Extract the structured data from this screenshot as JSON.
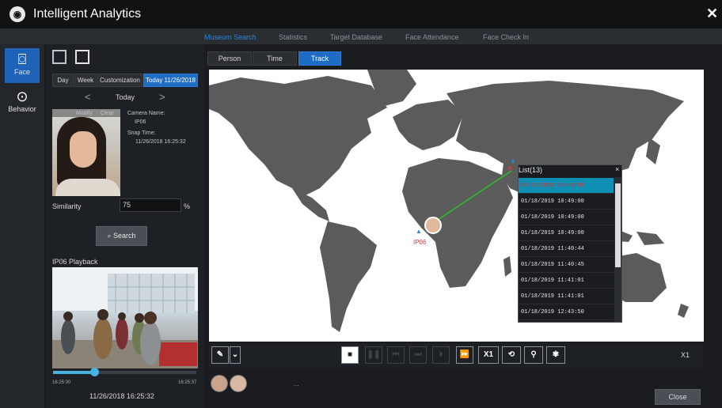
{
  "window": {
    "title": "Intelligent Analytics",
    "close_glyph": "✕"
  },
  "nav": {
    "tabs": [
      "Museum Search",
      "Statistics",
      "Target Database",
      "Face Attendance",
      "Face Check In"
    ],
    "active": "Museum Search"
  },
  "rail": {
    "items": [
      {
        "label": "Face",
        "icon": "face-scan-icon",
        "active": true
      },
      {
        "label": "Behavior",
        "icon": "behavior-search-icon",
        "active": false
      }
    ]
  },
  "left": {
    "range_tabs": [
      "Day",
      "Week",
      "Customization",
      "Today 11/26/2018"
    ],
    "date_nav": {
      "prev": "<",
      "label": "Today",
      "next": ">"
    },
    "snapshot": {
      "modify": "Modify",
      "clear": "Clear",
      "camera_name_label": "Camera Name:",
      "camera_name": "IP06",
      "snap_time_label": "Snap Time:",
      "snap_time": "11/26/2018 16:25:32"
    },
    "similarity": {
      "label": "Similarity",
      "value": "75",
      "unit": "%"
    },
    "search_button": "Search",
    "playback": {
      "label": "IP06 Playback",
      "start": "16:25:30",
      "end": "16:25:37",
      "timestamp": "11/26/2018 16:25:32",
      "progress": 0.29
    }
  },
  "tabs": [
    "Person",
    "Time",
    "Track"
  ],
  "active_tab": "Track",
  "map": {
    "markers": [
      {
        "label": "IP06",
        "color": "#d23535"
      },
      {
        "label": "",
        "color": "#d23535"
      }
    ],
    "track_color": "#2bbf2b",
    "land_color": "#5b5b5b"
  },
  "list": {
    "title": "List(13)",
    "close": "×",
    "items": [
      "01/18/2019 10:48:59",
      "01/18/2019 10:49:00",
      "01/18/2019 10:49:00",
      "01/18/2019 10:49:00",
      "01/18/2019 11:40:44",
      "01/18/2019 11:40:45",
      "01/18/2019 11:41:01",
      "01/18/2019 11:41:01",
      "01/18/2019 12:43:50"
    ],
    "selected_index": 0
  },
  "controls": {
    "speed": "X1",
    "speed_right": "X1",
    "dots": "..."
  },
  "close_button": "Close"
}
